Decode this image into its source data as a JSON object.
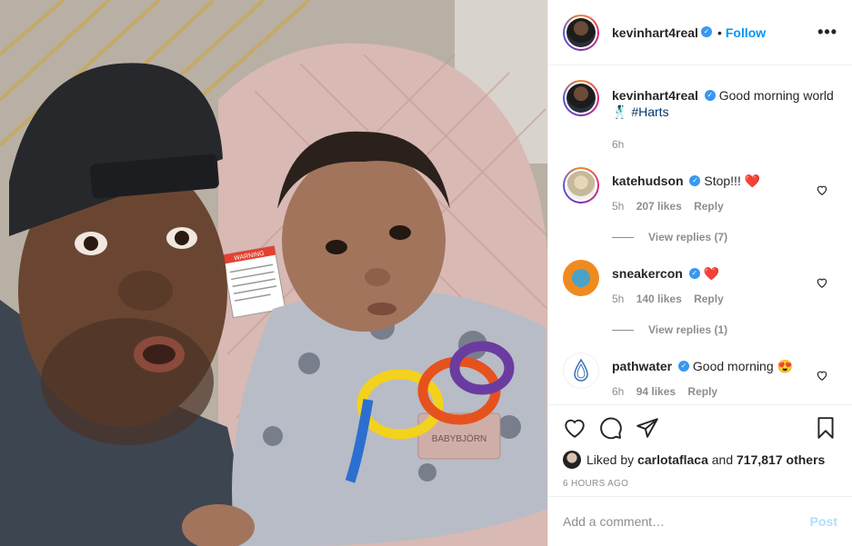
{
  "post": {
    "username": "kevinhart4real",
    "follow_label": "Follow",
    "more_icon": "more-options-icon",
    "photo_warning_label": "WARNING",
    "photo_brand_label": "BABYBJÖRN"
  },
  "caption": {
    "username": "kevinhart4real",
    "text_before": "Good morning world",
    "emoji": "🕺🏿",
    "hashtag": "#Harts",
    "time": "6h"
  },
  "comments": [
    {
      "username": "katehudson",
      "text": "Stop!!!",
      "emoji": "❤️",
      "time": "5h",
      "likes": "207 likes",
      "reply_label": "Reply",
      "view_replies": "View replies (7)"
    },
    {
      "username": "sneakercon",
      "text": "",
      "emoji": "❤️",
      "time": "5h",
      "likes": "140 likes",
      "reply_label": "Reply",
      "view_replies": "View replies (1)"
    },
    {
      "username": "pathwater",
      "text": "Good morning",
      "emoji": "😍",
      "time": "6h",
      "likes": "94 likes",
      "reply_label": "Reply"
    }
  ],
  "likes_line": {
    "prefix": "Liked by",
    "user": "carlotaflaca",
    "middle": "and",
    "count": "717,817 others"
  },
  "timestamp": "6 HOURS AGO",
  "comment_box": {
    "placeholder": "Add a comment…",
    "post_label": "Post"
  },
  "colors": {
    "link_blue": "#0095f6",
    "verified_blue": "#3897f0",
    "post_disabled": "#b2dffc"
  }
}
